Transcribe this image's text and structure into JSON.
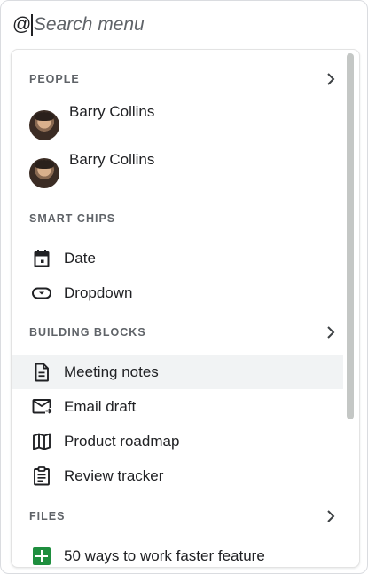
{
  "search": {
    "at_symbol": "@",
    "placeholder": "Search menu"
  },
  "sections": {
    "people": {
      "title": "PEOPLE",
      "items": [
        {
          "name": "Barry Collins"
        },
        {
          "name": "Barry Collins"
        }
      ]
    },
    "smart_chips": {
      "title": "SMART CHIPS",
      "items": [
        {
          "label": "Date",
          "icon": "calendar-icon"
        },
        {
          "label": "Dropdown",
          "icon": "dropdown-chip-icon"
        }
      ]
    },
    "building_blocks": {
      "title": "BUILDING BLOCKS",
      "items": [
        {
          "label": "Meeting notes",
          "icon": "document-icon",
          "highlighted": true
        },
        {
          "label": "Email draft",
          "icon": "email-draft-icon"
        },
        {
          "label": "Product roadmap",
          "icon": "map-icon"
        },
        {
          "label": "Review tracker",
          "icon": "clipboard-icon"
        }
      ]
    },
    "files": {
      "title": "FILES",
      "items": [
        {
          "label": "50 ways to work faster feature",
          "icon": "sheets-icon"
        }
      ]
    }
  },
  "colors": {
    "highlight": "#f1f3f4",
    "section_title": "#5f6368",
    "sheets_green": "#1e8e3e"
  }
}
